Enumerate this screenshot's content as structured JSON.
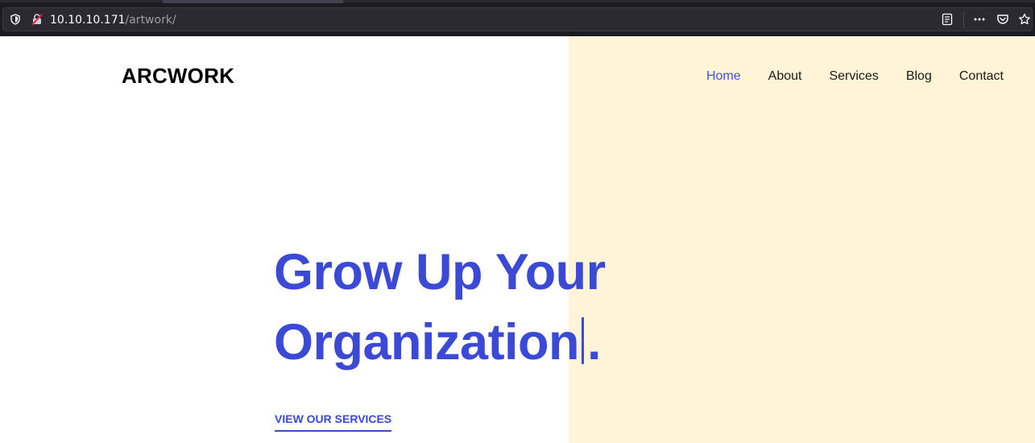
{
  "browser": {
    "url_host": "10.10.10.171",
    "url_path": "/artwork/",
    "icons": [
      "shield-icon",
      "insecure-connection-icon",
      "reader-view-icon",
      "more-actions-icon",
      "pocket-icon",
      "bookmark-star-icon"
    ]
  },
  "site": {
    "logo": "ARCWORK",
    "nav": {
      "home": "Home",
      "about": "About",
      "services": "Services",
      "blog": "Blog",
      "contact": "Contact"
    },
    "active_nav": "Home"
  },
  "hero": {
    "title_line1": "Grow Up Your",
    "title_line2": "Organization",
    "title_end": ".",
    "cta_label": "VIEW OUR SERVICES"
  },
  "colors": {
    "accent": "#3a49d6",
    "panel": "#fff4d7",
    "chrome": "#1c1b22"
  }
}
